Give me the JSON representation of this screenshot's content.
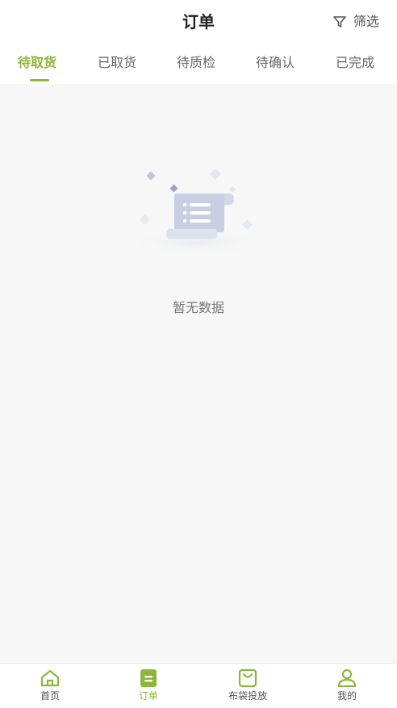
{
  "header": {
    "title": "订单",
    "filter_label": "筛选",
    "filter_icon": "filter-icon"
  },
  "tabs": [
    {
      "label": "待取货",
      "active": true
    },
    {
      "label": "已取货",
      "active": false
    },
    {
      "label": "待质检",
      "active": false
    },
    {
      "label": "待确认",
      "active": false
    },
    {
      "label": "已完成",
      "active": false
    }
  ],
  "empty_state": {
    "icon": "empty-document-icon",
    "message": "暂无数据"
  },
  "bottom_nav": [
    {
      "label": "首页",
      "icon": "home-icon",
      "active": false
    },
    {
      "label": "订单",
      "icon": "order-icon",
      "active": true
    },
    {
      "label": "布袋投放",
      "icon": "bag-icon",
      "active": false
    },
    {
      "label": "我的",
      "icon": "user-icon",
      "active": false
    }
  ],
  "colors": {
    "accent": "#8db63a",
    "background": "#f7f7f7",
    "text_primary": "#222222",
    "text_secondary": "#666666"
  }
}
